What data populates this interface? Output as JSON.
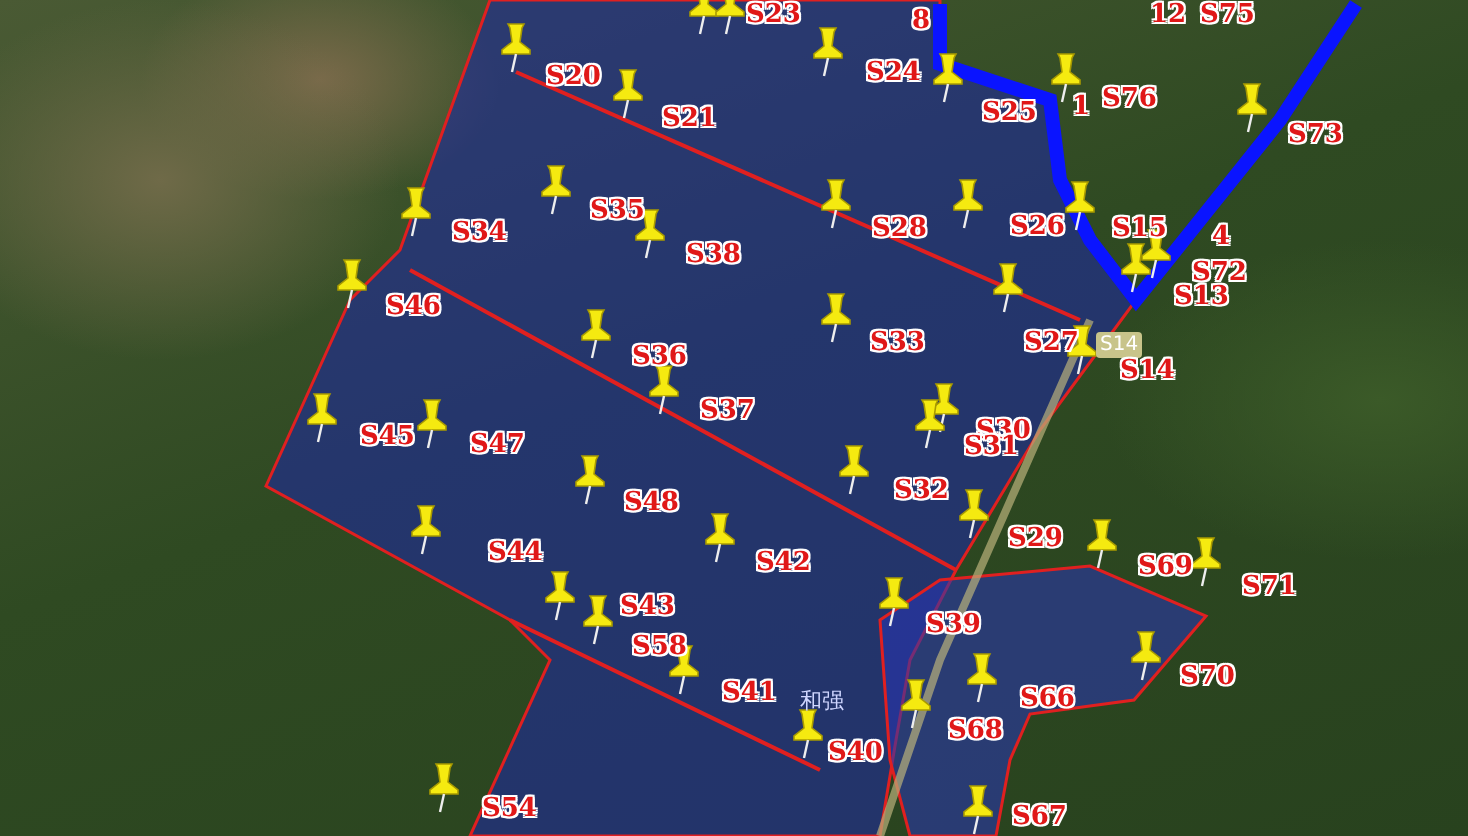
{
  "map": {
    "labels": [
      "S23",
      "8",
      "S25",
      "1",
      "S76",
      "12",
      "S75",
      "S73",
      "S20",
      "S21",
      "S24",
      "S34",
      "S35",
      "S38",
      "S28",
      "S26",
      "S15",
      "4",
      "S72",
      "S13",
      "S46",
      "S36",
      "S33",
      "S27",
      "S14",
      "S37",
      "S45",
      "S47",
      "S30",
      "S31",
      "S48",
      "S32",
      "S29",
      "S44",
      "S42",
      "S69",
      "S71",
      "S39",
      "S43",
      "S58",
      "S70",
      "S41",
      "S66",
      "S68",
      "S40",
      "S54",
      "S67"
    ],
    "road_shield": "S14",
    "place_name": "和强"
  }
}
